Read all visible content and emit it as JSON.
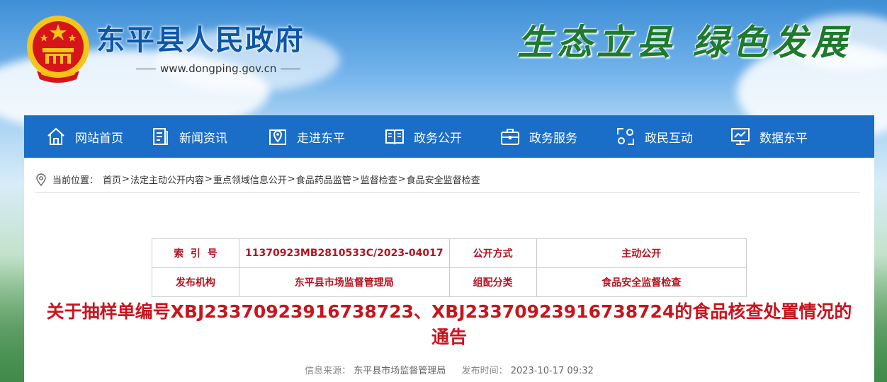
{
  "header": {
    "site_title": "东平县人民政府",
    "site_url": "www.dongping.gov.cn",
    "slogan": "生态立县  绿色发展",
    "emblem_icon": "national-emblem-icon"
  },
  "colors": {
    "nav_bg": "#1a6ec8",
    "title_blue": "#0e56a8",
    "slogan_green": "#1e7a2c",
    "accent_red": "#c8151d",
    "emblem_red": "#d7141a",
    "emblem_gold": "#f5c518"
  },
  "nav": {
    "items": [
      {
        "label": "网站首页",
        "icon": "home-icon"
      },
      {
        "label": "新闻资讯",
        "icon": "news-icon"
      },
      {
        "label": "走进东平",
        "icon": "map-pin-icon"
      },
      {
        "label": "政务公开",
        "icon": "book-icon"
      },
      {
        "label": "政务服务",
        "icon": "briefcase-icon"
      },
      {
        "label": "政民互动",
        "icon": "interaction-icon"
      },
      {
        "label": "数据东平",
        "icon": "monitor-chart-icon"
      }
    ]
  },
  "breadcrumb": {
    "prefix": "当前位置：",
    "items": [
      "首页",
      "法定主动公开内容",
      "重点领域信息公开",
      "食品药品监管",
      "监督检查",
      "食品安全监督检查"
    ],
    "separator": ">"
  },
  "meta_table": {
    "rows": [
      {
        "label1": "索  引  号",
        "value1": "11370923MB2810533C/2023-04017",
        "label2": "公开方式",
        "value2": "主动公开"
      },
      {
        "label1": "发布机构",
        "value1": "东平县市场监督管理局",
        "label2": "组配分类",
        "value2": "食品安全监督检查"
      }
    ]
  },
  "article": {
    "title": "关于抽样单编号XBJ23370923916738723、XBJ23370923916738724的食品核查处置情况的通告",
    "source_label": "信息来源：",
    "source": "东平县市场监督管理局",
    "time_label": "发布时间：",
    "time": "2023-10-17 09:32"
  }
}
